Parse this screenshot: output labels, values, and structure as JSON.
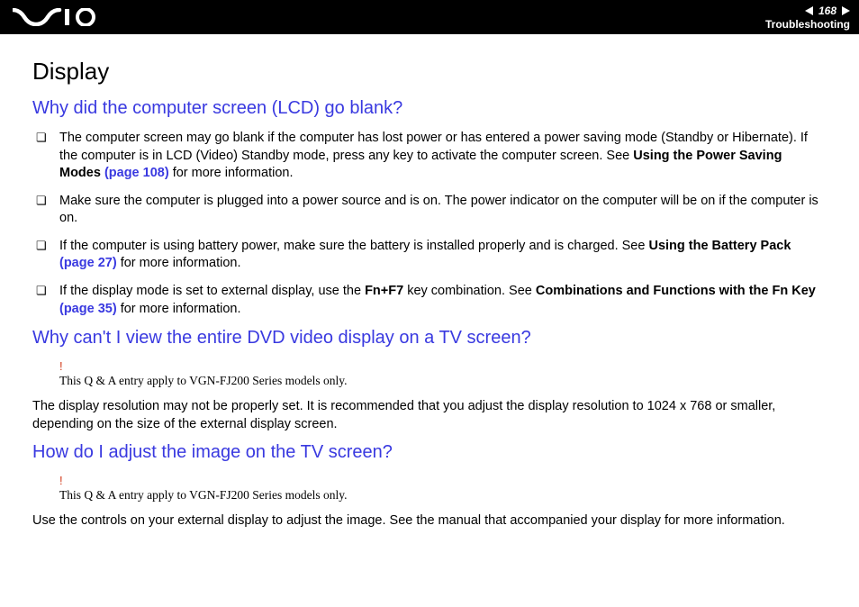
{
  "header": {
    "page_number": "168",
    "section": "Troubleshooting"
  },
  "content": {
    "title": "Display",
    "q1": {
      "heading": "Why did the computer screen (LCD) go blank?",
      "items": [
        {
          "pre": "The computer screen may go blank if the computer has lost power or has entered a power saving mode (Standby or Hibernate). If the computer is in LCD (Video) Standby mode, press any key to activate the computer screen. See ",
          "bold1": "Using the Power Saving Modes ",
          "link": "(page 108)",
          "post": " for more information."
        },
        {
          "pre": "Make sure the computer is plugged into a power source and is on. The power indicator on the computer will be on if the computer is on.",
          "bold1": "",
          "link": "",
          "post": ""
        },
        {
          "pre": "If the computer is using battery power, make sure the battery is installed properly and is charged. See ",
          "bold1": "Using the Battery Pack ",
          "link": "(page 27)",
          "post": " for more information."
        },
        {
          "pre": "If the display mode is set to external display, use the ",
          "bold0": "Fn+F7",
          "mid": " key combination. See ",
          "bold1": "Combinations and Functions with the Fn Key ",
          "link": "(page 35)",
          "post": " for more information."
        }
      ]
    },
    "q2": {
      "heading": "Why can't I view the entire DVD video display on a TV screen?",
      "note_bang": "!",
      "note": "This Q & A entry apply to VGN-FJ200 Series models only.",
      "body": "The display resolution may not be properly set. It is recommended that you adjust the display resolution to 1024 x 768 or smaller, depending on the size of the external display screen."
    },
    "q3": {
      "heading": "How do I adjust the image on the TV screen?",
      "note_bang": "!",
      "note": "This Q & A entry apply to VGN-FJ200 Series models only.",
      "body": "Use the controls on your external display to adjust the image. See the manual that accompanied your display for more information."
    }
  }
}
